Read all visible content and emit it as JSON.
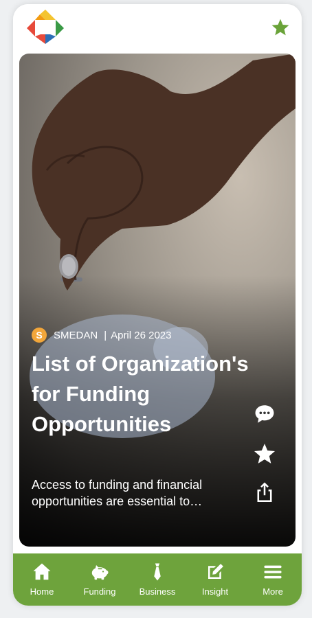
{
  "header": {
    "favorite_icon": "star-icon"
  },
  "article": {
    "source_initial": "S",
    "source": "SMEDAN",
    "separator": "|",
    "date": "April 26 2023",
    "title": "List of Organization's for Funding Opportunities",
    "excerpt": "Access to funding and financial opportunities are essential to…"
  },
  "actions": [
    "comment-icon",
    "star-icon",
    "share-icon"
  ],
  "nav": [
    {
      "label": "Home",
      "icon": "home-icon"
    },
    {
      "label": "Funding",
      "icon": "piggy-bank-icon"
    },
    {
      "label": "Business",
      "icon": "tie-icon"
    },
    {
      "label": "Insight",
      "icon": "edit-icon"
    },
    {
      "label": "More",
      "icon": "menu-icon"
    }
  ],
  "colors": {
    "brand_green": "#6ea33c",
    "badge_orange": "#f2a63a",
    "star_green": "#6aa339"
  }
}
